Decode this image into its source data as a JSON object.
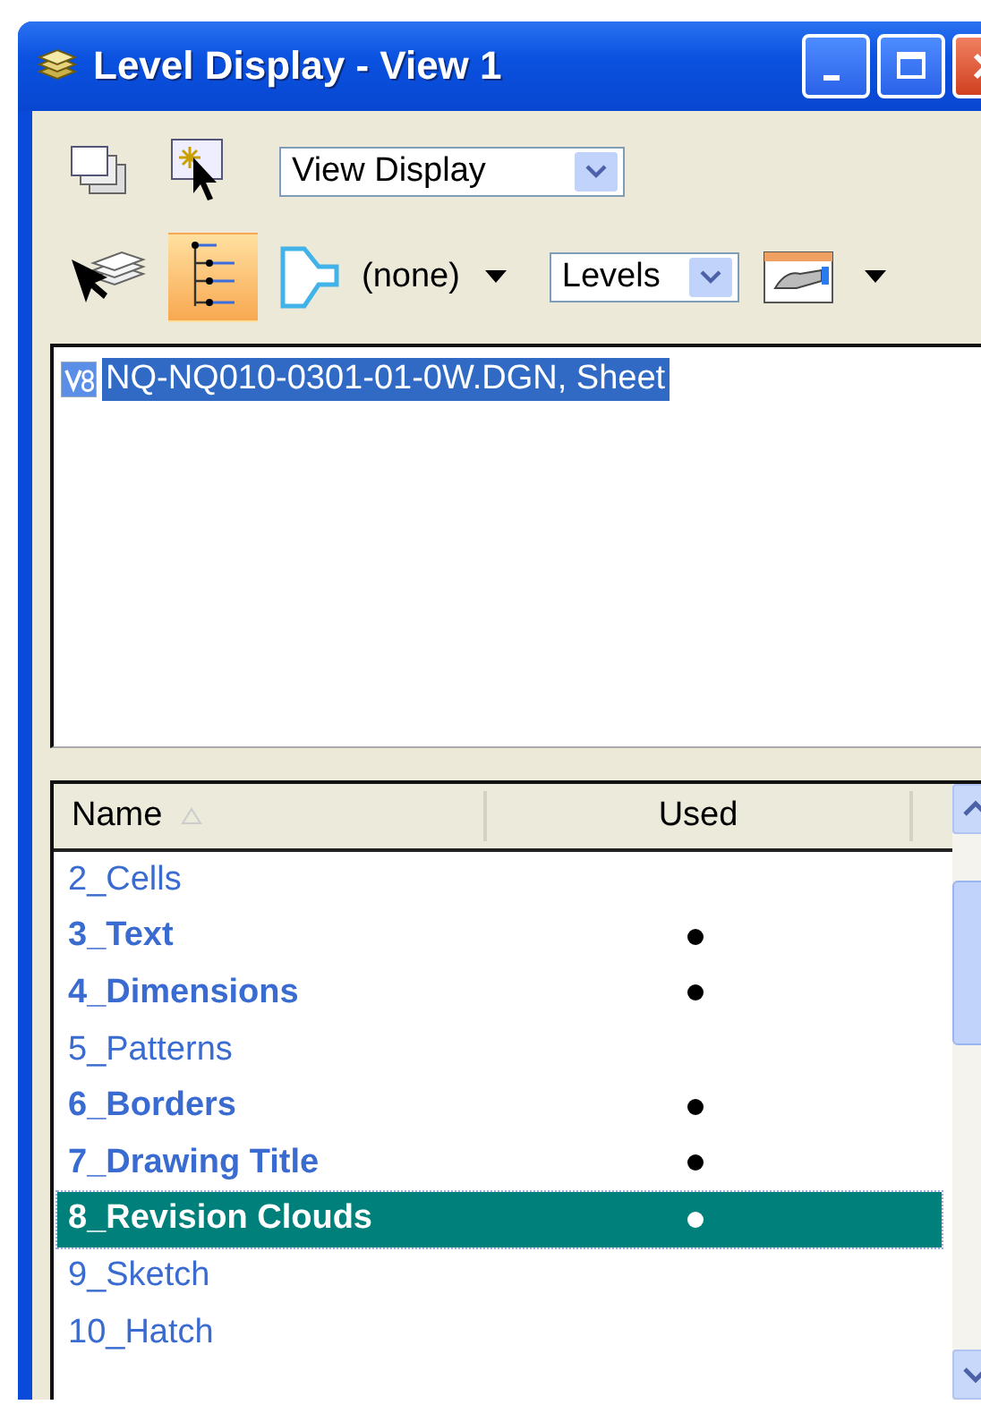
{
  "window": {
    "title": "Level Display - View 1"
  },
  "toolbar": {
    "view_dropdown": {
      "value": "View Display"
    },
    "hierarchy_toggle": {
      "on": true
    },
    "filter": {
      "value": "(none)"
    },
    "type_dropdown": {
      "value": "Levels"
    }
  },
  "tree": {
    "items": [
      {
        "label": "NQ-NQ010-0301-01-0W.DGN, Sheet",
        "selected": true
      }
    ]
  },
  "list": {
    "columns": [
      {
        "label": "Name",
        "sorted": true
      },
      {
        "label": "Used",
        "sorted": false
      }
    ],
    "rows": [
      {
        "name": "2_Cells",
        "used": false,
        "selected": false
      },
      {
        "name": "3_Text",
        "used": true,
        "selected": false
      },
      {
        "name": "4_Dimensions",
        "used": true,
        "selected": false
      },
      {
        "name": "5_Patterns",
        "used": false,
        "selected": false
      },
      {
        "name": "6_Borders",
        "used": true,
        "selected": false
      },
      {
        "name": "7_Drawing Title",
        "used": true,
        "selected": false
      },
      {
        "name": "8_Revision Clouds",
        "used": true,
        "selected": true
      },
      {
        "name": "9_Sketch",
        "used": false,
        "selected": false
      },
      {
        "name": "10_Hatch",
        "used": false,
        "selected": false
      }
    ]
  }
}
